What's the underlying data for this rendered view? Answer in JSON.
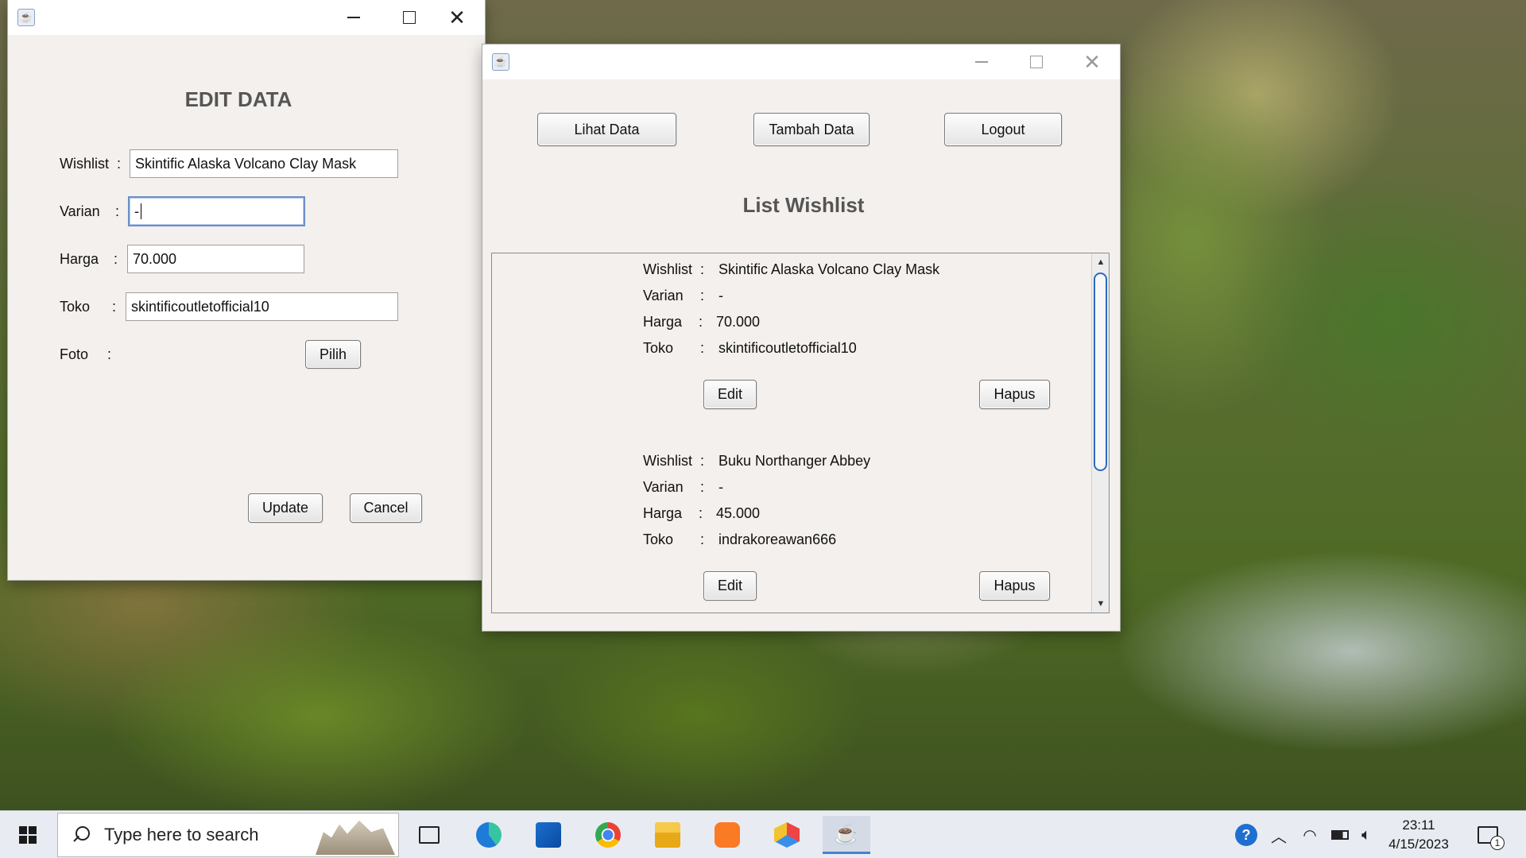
{
  "edit_window": {
    "title": "",
    "heading": "EDIT DATA",
    "fields": {
      "wishlist": {
        "label": "Wishlist",
        "value": "Skintific Alaska Volcano Clay Mask"
      },
      "varian": {
        "label": "Varian",
        "value": "-"
      },
      "harga": {
        "label": "Harga",
        "value": "70.000"
      },
      "toko": {
        "label": "Toko",
        "value": "skintificoutletofficial10"
      },
      "foto": {
        "label": "Foto"
      }
    },
    "colon": ":",
    "pilih_label": "Pilih",
    "update_label": "Update",
    "cancel_label": "Cancel"
  },
  "list_window": {
    "title": "",
    "nav": {
      "lihat_label": "Lihat Data",
      "tambah_label": "Tambah Data",
      "logout_label": "Logout"
    },
    "heading": "List Wishlist",
    "colon": ":",
    "labels": {
      "wishlist": "Wishlist",
      "varian": "Varian",
      "harga": "Harga",
      "toko": "Toko"
    },
    "edit_label": "Edit",
    "hapus_label": "Hapus",
    "items": [
      {
        "wishlist": "Skintific Alaska Volcano Clay Mask",
        "varian": "-",
        "harga": "70.000",
        "toko": "skintificoutletofficial10"
      },
      {
        "wishlist": "Buku Northanger Abbey",
        "varian": "-",
        "harga": "45.000",
        "toko": "indrakoreawan666"
      }
    ]
  },
  "taskbar": {
    "search_placeholder": "Type here to search",
    "time": "23:11",
    "date": "4/15/2023",
    "notification_count": "1",
    "apps": [
      "task-view-icon",
      "edge-icon",
      "store-icon",
      "chrome-icon",
      "file-explorer-icon",
      "xampp-icon",
      "cube-app-icon",
      "java-icon"
    ],
    "accent_color": "#4a7fd0"
  }
}
